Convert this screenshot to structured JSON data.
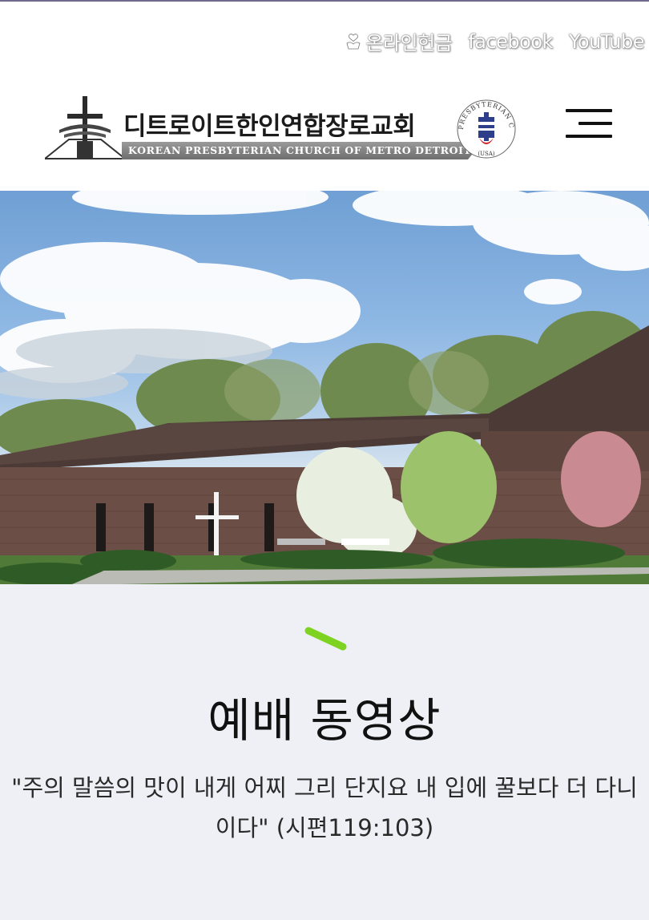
{
  "utility_links": {
    "online_offering": "온라인헌금",
    "facebook": "facebook",
    "youtube": "YouTube",
    "offering_icon": "hand-heart-icon"
  },
  "header": {
    "logo_title_ko": "디트로이트한인연합장로교회",
    "logo_title_en": "KOREAN PRESBYTERIAN CHURCH OF METRO DETROIT",
    "seal_text": "PRESBYTERIAN CHURCH",
    "seal_sub": "(USA)",
    "menu_icon": "hamburger-menu-icon"
  },
  "hero": {
    "slide_count": 2,
    "active_slide": 2
  },
  "video_section": {
    "title": "예배 동영상",
    "verse": "\"주의 말씀의 맛이 내게 어찌 그리 단지요 내 입에 꿀보다 더 다니이다\" (시편119:103)",
    "accent_color": "#7ed321"
  },
  "colors": {
    "section_bg": "#eef0f6",
    "top_border": "#6d6a8c",
    "accent": "#7ed321"
  }
}
